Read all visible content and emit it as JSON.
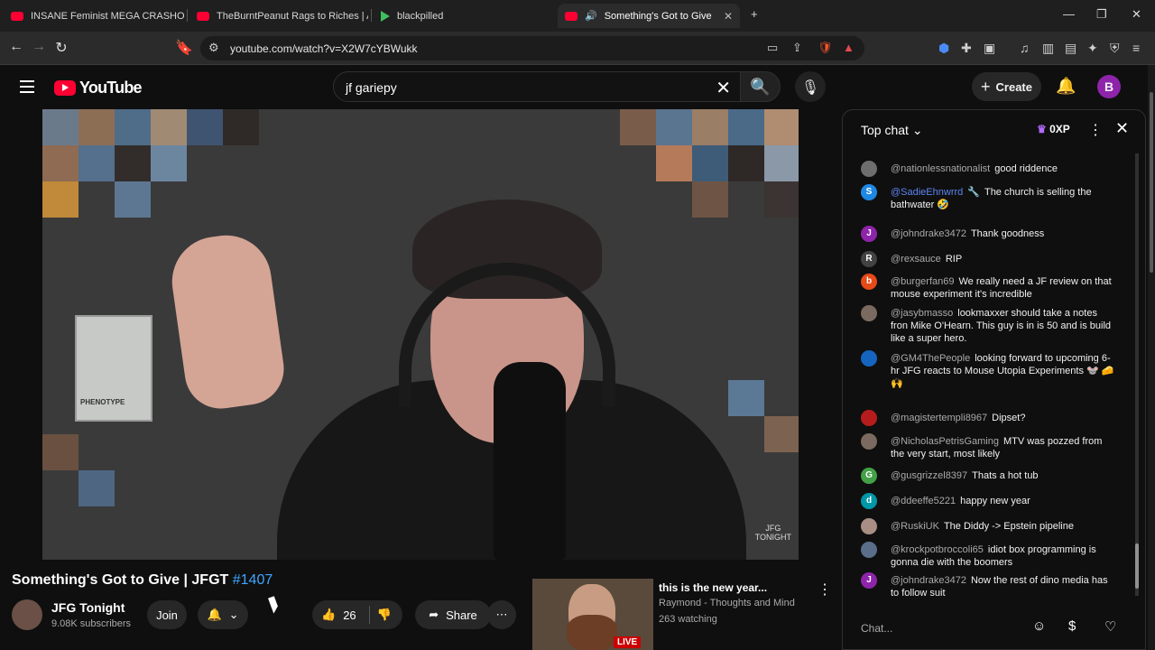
{
  "browser": {
    "tabs": [
      {
        "label": "INSANE Feminist MEGA CRASHOUT",
        "icon": "youtube-icon"
      },
      {
        "label": "TheBurntPeanut Rags to Riches | ARC",
        "icon": "youtube-icon"
      },
      {
        "label": "blackpilled",
        "icon": "play-icon"
      },
      {
        "label": "Something's Got to Give | JFG",
        "icon": "youtube-icon"
      }
    ],
    "new_tab": "+",
    "url": "youtube.com/watch?v=X2W7cYBWukk"
  },
  "youtube": {
    "logo_text": "YouTube",
    "search_value": "jf gariepy",
    "create_label": "Create",
    "account_initial": "B"
  },
  "video": {
    "book_text": "PHENOTYPE",
    "watermark_line1": "JFG",
    "watermark_line2": "TONIGHT",
    "title": "Something's Got to Give | JFGT",
    "title_tag": "#1407",
    "channel_name": "JFG Tonight",
    "subscribers": "9.08K subscribers",
    "join_label": "Join",
    "like_count": "26",
    "share_label": "Share"
  },
  "recommendation": {
    "title": "this is the new year...",
    "channel": "Raymond - Thoughts and Mind",
    "watching": "263 watching",
    "live_badge": "LIVE"
  },
  "chat": {
    "header": "Top chat",
    "xp": "0XP",
    "input_placeholder": "Chat...",
    "messages": [
      {
        "author": "@nationlessnationalist",
        "text": "good riddence",
        "initial": "",
        "color": "#6e6e6e"
      },
      {
        "author": "@SadieEhnwrrd",
        "text": "The church is selling the bathwater 🤣",
        "initial": "S",
        "color": "#1e88e5",
        "mod": true
      },
      {
        "author": "@johndrake3472",
        "text": "Thank goodness",
        "initial": "J",
        "color": "#8e24aa"
      },
      {
        "author": "@rexsauce",
        "text": "RIP",
        "initial": "R",
        "color": "#424242"
      },
      {
        "author": "@burgerfan69",
        "text": "We really need a JF review on that mouse experiment it's incredible",
        "initial": "b",
        "color": "#e64a19"
      },
      {
        "author": "@jasybmasso",
        "text": "lookmaxxer should take a notes fron Mike O'Hearn. This guy is in is 50 and is build like a super hero.",
        "initial": "",
        "color": "#7a6a60"
      },
      {
        "author": "@GM4ThePeople",
        "text": "looking forward to upcoming 6-hr JFG reacts to Mouse Utopia Experiments 🐭 🧀 🙌",
        "initial": "",
        "color": "#1565c0"
      },
      {
        "author": "@magistertempli8967",
        "text": "Dipset?",
        "initial": "",
        "color": "#b71c1c"
      },
      {
        "author": "@NicholasPetrisGaming",
        "text": "MTV was pozzed from the very start, most likely",
        "initial": "",
        "color": "#7a6a60"
      },
      {
        "author": "@gusgrizzel8397",
        "text": "Thats a hot tub",
        "initial": "G",
        "color": "#43a047"
      },
      {
        "author": "@ddeeffe5221",
        "text": "happy new year",
        "initial": "d",
        "color": "#0097a7"
      },
      {
        "author": "@RuskiUK",
        "text": "The Diddy -> Epstein pipeline",
        "initial": "",
        "color": "#a88e84"
      },
      {
        "author": "@krockpotbroccoli65",
        "text": "idiot box programming is gonna die with the boomers",
        "initial": "",
        "color": "#5a6e8a"
      },
      {
        "author": "@johndrake3472",
        "text": "Now the rest of dino media has to follow suit",
        "initial": "J",
        "color": "#8e24aa"
      }
    ]
  }
}
